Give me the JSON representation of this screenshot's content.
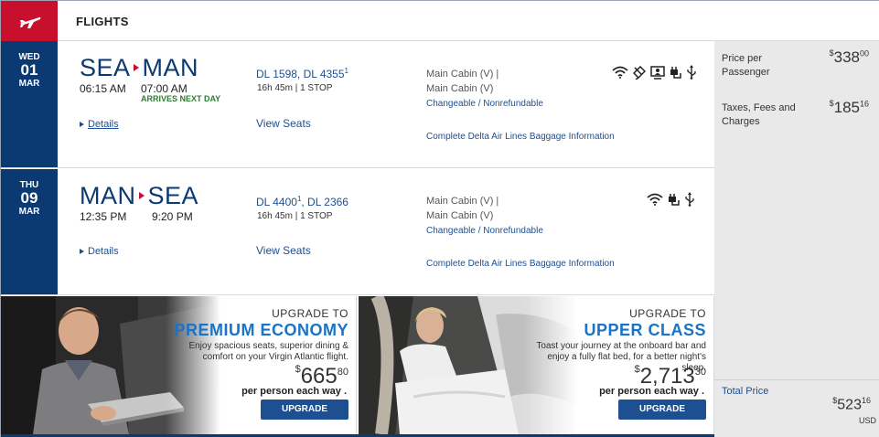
{
  "header": {
    "title": "FLIGHTS",
    "icon": "airplane-icon"
  },
  "flights": [
    {
      "date": {
        "dow": "WED",
        "day": "01",
        "month": "MAR"
      },
      "origin": "SEA",
      "destination": "MAN",
      "depart_time": "06:15 AM",
      "arrive_time": "07:00 AM",
      "arrive_note": "ARRIVES NEXT DAY",
      "flight_a": "DL 1598, DL 4355",
      "flight_a_sup": "1",
      "flight_b": "",
      "flight_b_sup": "",
      "duration": "16h 45m | 1 STOP",
      "details_label": "Details",
      "view_seats_label": "View Seats",
      "cabin_1": "Main Cabin (V) |",
      "cabin_2": "Main Cabin (V)",
      "changeable": "Changeable / Nonrefundable",
      "baggage": "Complete Delta Air Lines Baggage Information",
      "amenities": [
        "wifi-icon",
        "satellite-tv-icon",
        "personal-screen-icon",
        "power-plug-icon",
        "usb-icon"
      ]
    },
    {
      "date": {
        "dow": "THU",
        "day": "09",
        "month": "MAR"
      },
      "origin": "MAN",
      "destination": "SEA",
      "depart_time": "12:35 PM",
      "arrive_time": "9:20 PM",
      "arrive_note": "",
      "flight_a": "DL 4400",
      "flight_a_sup": "1",
      "flight_b": ", DL 2366",
      "flight_b_sup": "",
      "duration": "16h 45m | 1 STOP",
      "details_label": "Details",
      "view_seats_label": "View Seats",
      "cabin_1": "Main Cabin (V) |",
      "cabin_2": "Main Cabin (V)",
      "changeable": "Changeable / Nonrefundable",
      "baggage": "Complete Delta Air Lines Baggage Information",
      "amenities": [
        "wifi-icon",
        "power-plug-icon",
        "usb-icon"
      ]
    }
  ],
  "price": {
    "per_passenger_label": "Price per Passenger",
    "per_passenger_symbol": "$",
    "per_passenger_whole": "338",
    "per_passenger_cents": "00",
    "taxes_label": "Taxes, Fees and Charges",
    "taxes_symbol": "$",
    "taxes_whole": "185",
    "taxes_cents": "16",
    "total_label": "Total Price",
    "total_symbol": "$",
    "total_whole": "523",
    "total_cents": "16",
    "currency": "USD"
  },
  "promos": [
    {
      "line1": "UPGRADE TO",
      "line2": "PREMIUM ECONOMY",
      "desc": "Enjoy spacious seats, superior dining & comfort on your Virgin Atlantic flight.",
      "symbol": "$",
      "whole": "665",
      "cents": "80",
      "each": "per person each way .",
      "button": "UPGRADE"
    },
    {
      "line1": "UPGRADE TO",
      "line2": "UPPER CLASS",
      "desc": "Toast your journey at the onboard bar and enjoy a fully flat bed, for a better night's sleep.",
      "symbol": "$",
      "whole": "2,713",
      "cents": "30",
      "each": "per person each way .",
      "button": "UPGRADE"
    }
  ],
  "colors": {
    "delta_red": "#c8102e",
    "navy": "#0b3a73",
    "link_blue": "#1d4f91",
    "promo_blue": "#1a73c7"
  }
}
